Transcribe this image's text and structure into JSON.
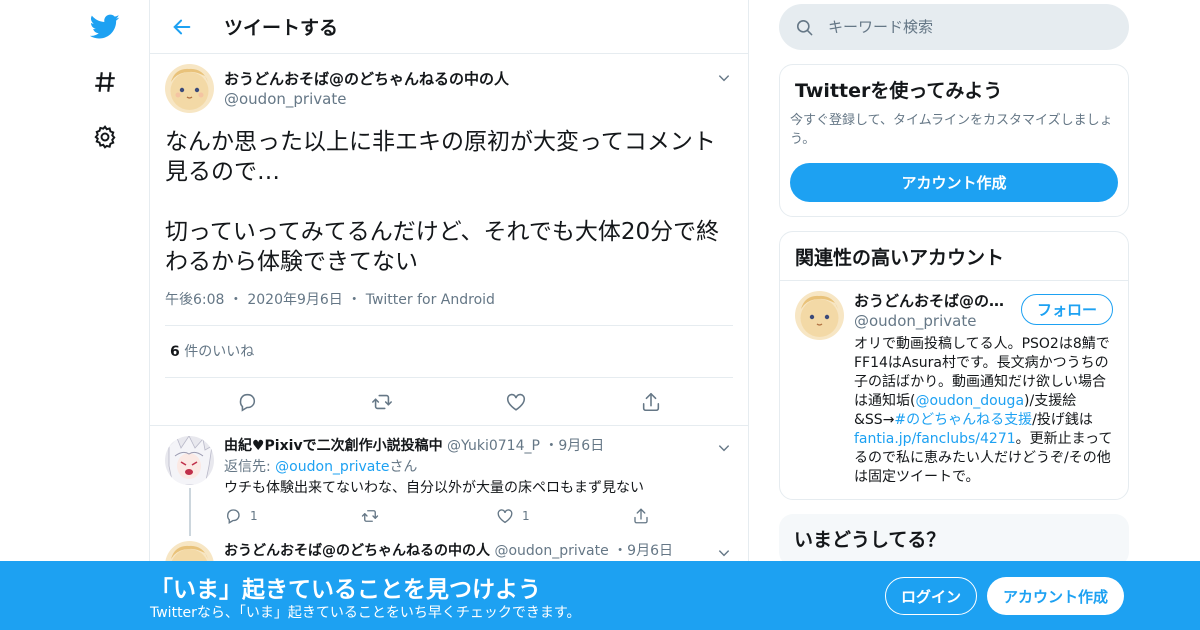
{
  "header": {
    "title": "ツイートする"
  },
  "main_tweet": {
    "display_name": "おうどんおそば@のどちゃんねるの中の人",
    "handle": "@oudon_private",
    "text": "なんか思った以上に非エキの原初が大変ってコメント見るので…\n\n切っていってみてるんだけど、それでも大体20分で終わるから体験できてない",
    "time": "午後6:08",
    "date": "2020年9月6日",
    "source": "Twitter for Android",
    "likes_count": "6",
    "likes_label": "件のいいね"
  },
  "replies": [
    {
      "display_name": "由紀♥Pixivで二次創作小説投稿中",
      "handle": "@Yuki0714_P",
      "date": "9月6日",
      "reply_to_label": "返信先:",
      "reply_to_handle": "@oudon_private",
      "reply_to_suffix": "さん",
      "text": "ウチも体験出来てないわな、自分以外が大量の床ペロもまず見ない",
      "reply_count": "1",
      "like_count": "1"
    },
    {
      "display_name": "おうどんおそば@のどちゃんねるの中の人",
      "handle": "@oudon_private",
      "date": "9月6日"
    }
  ],
  "search": {
    "placeholder": "キーワード検索"
  },
  "signup_card": {
    "title": "Twitterを使ってみよう",
    "desc": "今すぐ登録して、タイムラインをカスタマイズしましょう。",
    "button": "アカウント作成"
  },
  "related_card": {
    "title": "関連性の高いアカウント",
    "account": {
      "display_name": "おうどんおそば@の…",
      "handle": "@oudon_private",
      "follow_label": "フォロー",
      "bio_1": "オリで動画投稿してる人。PSO2は8鯖でFF14はAsura村です。長文病かつうちの子の話ばかり。動画通知だけ欲しい場合は通知垢(",
      "bio_link_1": "@oudon_douga",
      "bio_2": ")/支援絵&SS→",
      "bio_link_2": "#のどちゃんねる支援",
      "bio_3": "/投げ銭は",
      "bio_link_3": "fantia.jp/fanclubs/4271",
      "bio_4": "。更新止まってるので私に恵みたい人だけどうぞ/その他は固定ツイートで。"
    }
  },
  "trends_card": {
    "title": "いまどうしてる？"
  },
  "banner": {
    "title": "「いま」起きていることを見つけよう",
    "subtitle": "Twitterなら、「いま」起きていることをいち早くチェックできます。",
    "login": "ログイン",
    "signup": "アカウント作成"
  },
  "colors": {
    "accent": "#1da1f2",
    "secondary_text": "#657786",
    "border": "#e6ecf0",
    "like_heart": "#e0245e"
  },
  "icons": [
    "twitter-logo-icon",
    "hashtag-icon",
    "gear-icon",
    "back-arrow-icon",
    "chevron-down-icon",
    "reply-icon",
    "retweet-icon",
    "like-icon",
    "share-icon",
    "search-icon"
  ]
}
